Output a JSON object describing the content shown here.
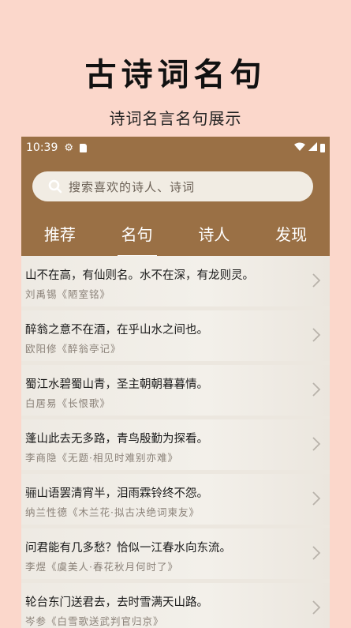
{
  "hero": {
    "title": "古诗词名句",
    "subtitle": "诗词名言名句展示"
  },
  "status": {
    "time": "10:39"
  },
  "search": {
    "placeholder": "搜索喜欢的诗人、诗词"
  },
  "tabs": [
    {
      "label": "推荐"
    },
    {
      "label": "名句",
      "active": true
    },
    {
      "label": "诗人"
    },
    {
      "label": "发现"
    }
  ],
  "quotes": [
    {
      "text": "山不在高，有仙则名。水不在深，有龙则灵。",
      "source": "刘禹锡《陋室铭》"
    },
    {
      "text": "醉翁之意不在酒，在乎山水之间也。",
      "source": "欧阳修《醉翁亭记》"
    },
    {
      "text": "蜀江水碧蜀山青，圣主朝朝暮暮情。",
      "source": "白居易《长恨歌》"
    },
    {
      "text": "蓬山此去无多路，青鸟殷勤为探看。",
      "source": "李商隐《无题·相见时难别亦难》"
    },
    {
      "text": "骊山语罢清宵半，泪雨霖铃终不怨。",
      "source": "纳兰性德《木兰花·拟古决绝词柬友》"
    },
    {
      "text": "问君能有几多愁？恰似一江春水向东流。",
      "source": "李煜《虞美人·春花秋月何时了》"
    },
    {
      "text": "轮台东门送君去，去时雪满天山路。",
      "source": "岑参《白雪歌送武判官归京》"
    }
  ]
}
